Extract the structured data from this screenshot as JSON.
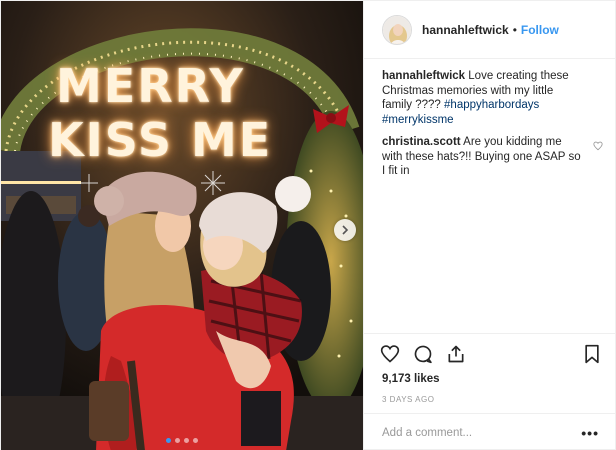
{
  "post": {
    "sign_line1": "MERRY",
    "sign_line2": "KISS ME",
    "carousel_count": 4,
    "carousel_active": 0
  },
  "header": {
    "username": "hannahleftwick",
    "separator": "•",
    "follow_label": "Follow"
  },
  "caption": {
    "username": "hannahleftwick",
    "text": "Love creating these Christmas memories with my little family",
    "emoji": "????",
    "hashtags": [
      "#happyharbordays",
      "#merrykissme"
    ]
  },
  "comments": [
    {
      "username": "christina.scott",
      "text": "Are you kidding me with these hats?!! Buying one ASAP so I fit in"
    }
  ],
  "likes": "9,173 likes",
  "date": "3 DAYS AGO",
  "add_comment": {
    "placeholder": "Add a comment..."
  },
  "more_label": "•••",
  "icons": {
    "like": "heart-icon",
    "comment": "comment-icon",
    "share": "share-icon",
    "save": "bookmark-icon",
    "next": "chevron-right-icon"
  },
  "colors": {
    "link": "#3897f0",
    "hashtag": "#003569",
    "muted": "#999999",
    "text": "#262626"
  }
}
